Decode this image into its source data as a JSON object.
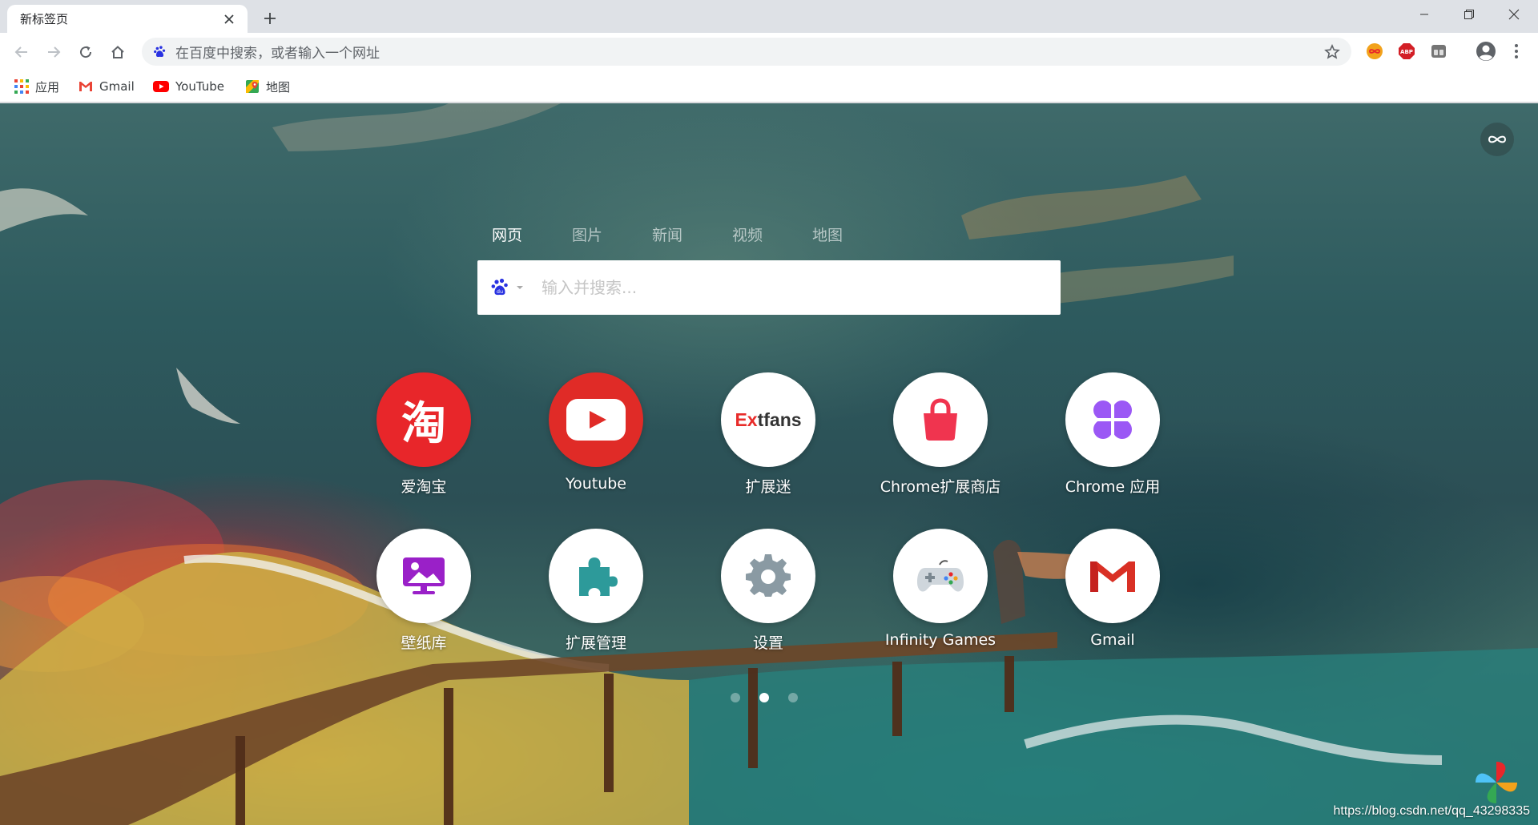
{
  "tab": {
    "title": "新标签页"
  },
  "toolbar": {
    "omnibox_placeholder": "在百度中搜索，或者输入一个网址"
  },
  "bookmarks": [
    {
      "label": "应用",
      "icon": "apps-grid-icon"
    },
    {
      "label": "Gmail",
      "icon": "gmail-icon"
    },
    {
      "label": "YouTube",
      "icon": "youtube-icon"
    },
    {
      "label": "地图",
      "icon": "maps-icon"
    }
  ],
  "newtab": {
    "search_tabs": [
      "网页",
      "图片",
      "新闻",
      "视频",
      "地图"
    ],
    "active_search_tab": "网页",
    "search_placeholder": "输入并搜索...",
    "tiles_row1": [
      {
        "label": "爱淘宝",
        "icon": "taobao-icon",
        "glyph": "淘"
      },
      {
        "label": "Youtube",
        "icon": "youtube-icon"
      },
      {
        "label": "扩展迷",
        "icon": "extfans-icon",
        "logo_red": "Ex",
        "logo_dark": "tfans"
      },
      {
        "label": "Chrome扩展商店",
        "icon": "shopping-bag-icon"
      },
      {
        "label": "Chrome 应用",
        "icon": "clover-icon"
      }
    ],
    "tiles_row2": [
      {
        "label": "壁纸库",
        "icon": "wallpaper-icon"
      },
      {
        "label": "扩展管理",
        "icon": "puzzle-icon"
      },
      {
        "label": "设置",
        "icon": "gear-icon"
      },
      {
        "label": "Infinity Games",
        "icon": "gamepad-icon"
      },
      {
        "label": "Gmail",
        "icon": "gmail-icon"
      }
    ],
    "pager": {
      "pages": 3,
      "current": 2
    }
  },
  "watermark": "https://blog.csdn.net/qq_43298335",
  "colors": {
    "taobao": "#e8262a",
    "youtube": "#e02b27",
    "extfans_red": "#e82c2a",
    "store_pink": "#f0344f",
    "chrome_apps_purple": "#9b58f5",
    "wallpaper_purple": "#9a20c8",
    "puzzle_teal": "#2d9a9a",
    "gear_gray": "#8a9aa3"
  }
}
